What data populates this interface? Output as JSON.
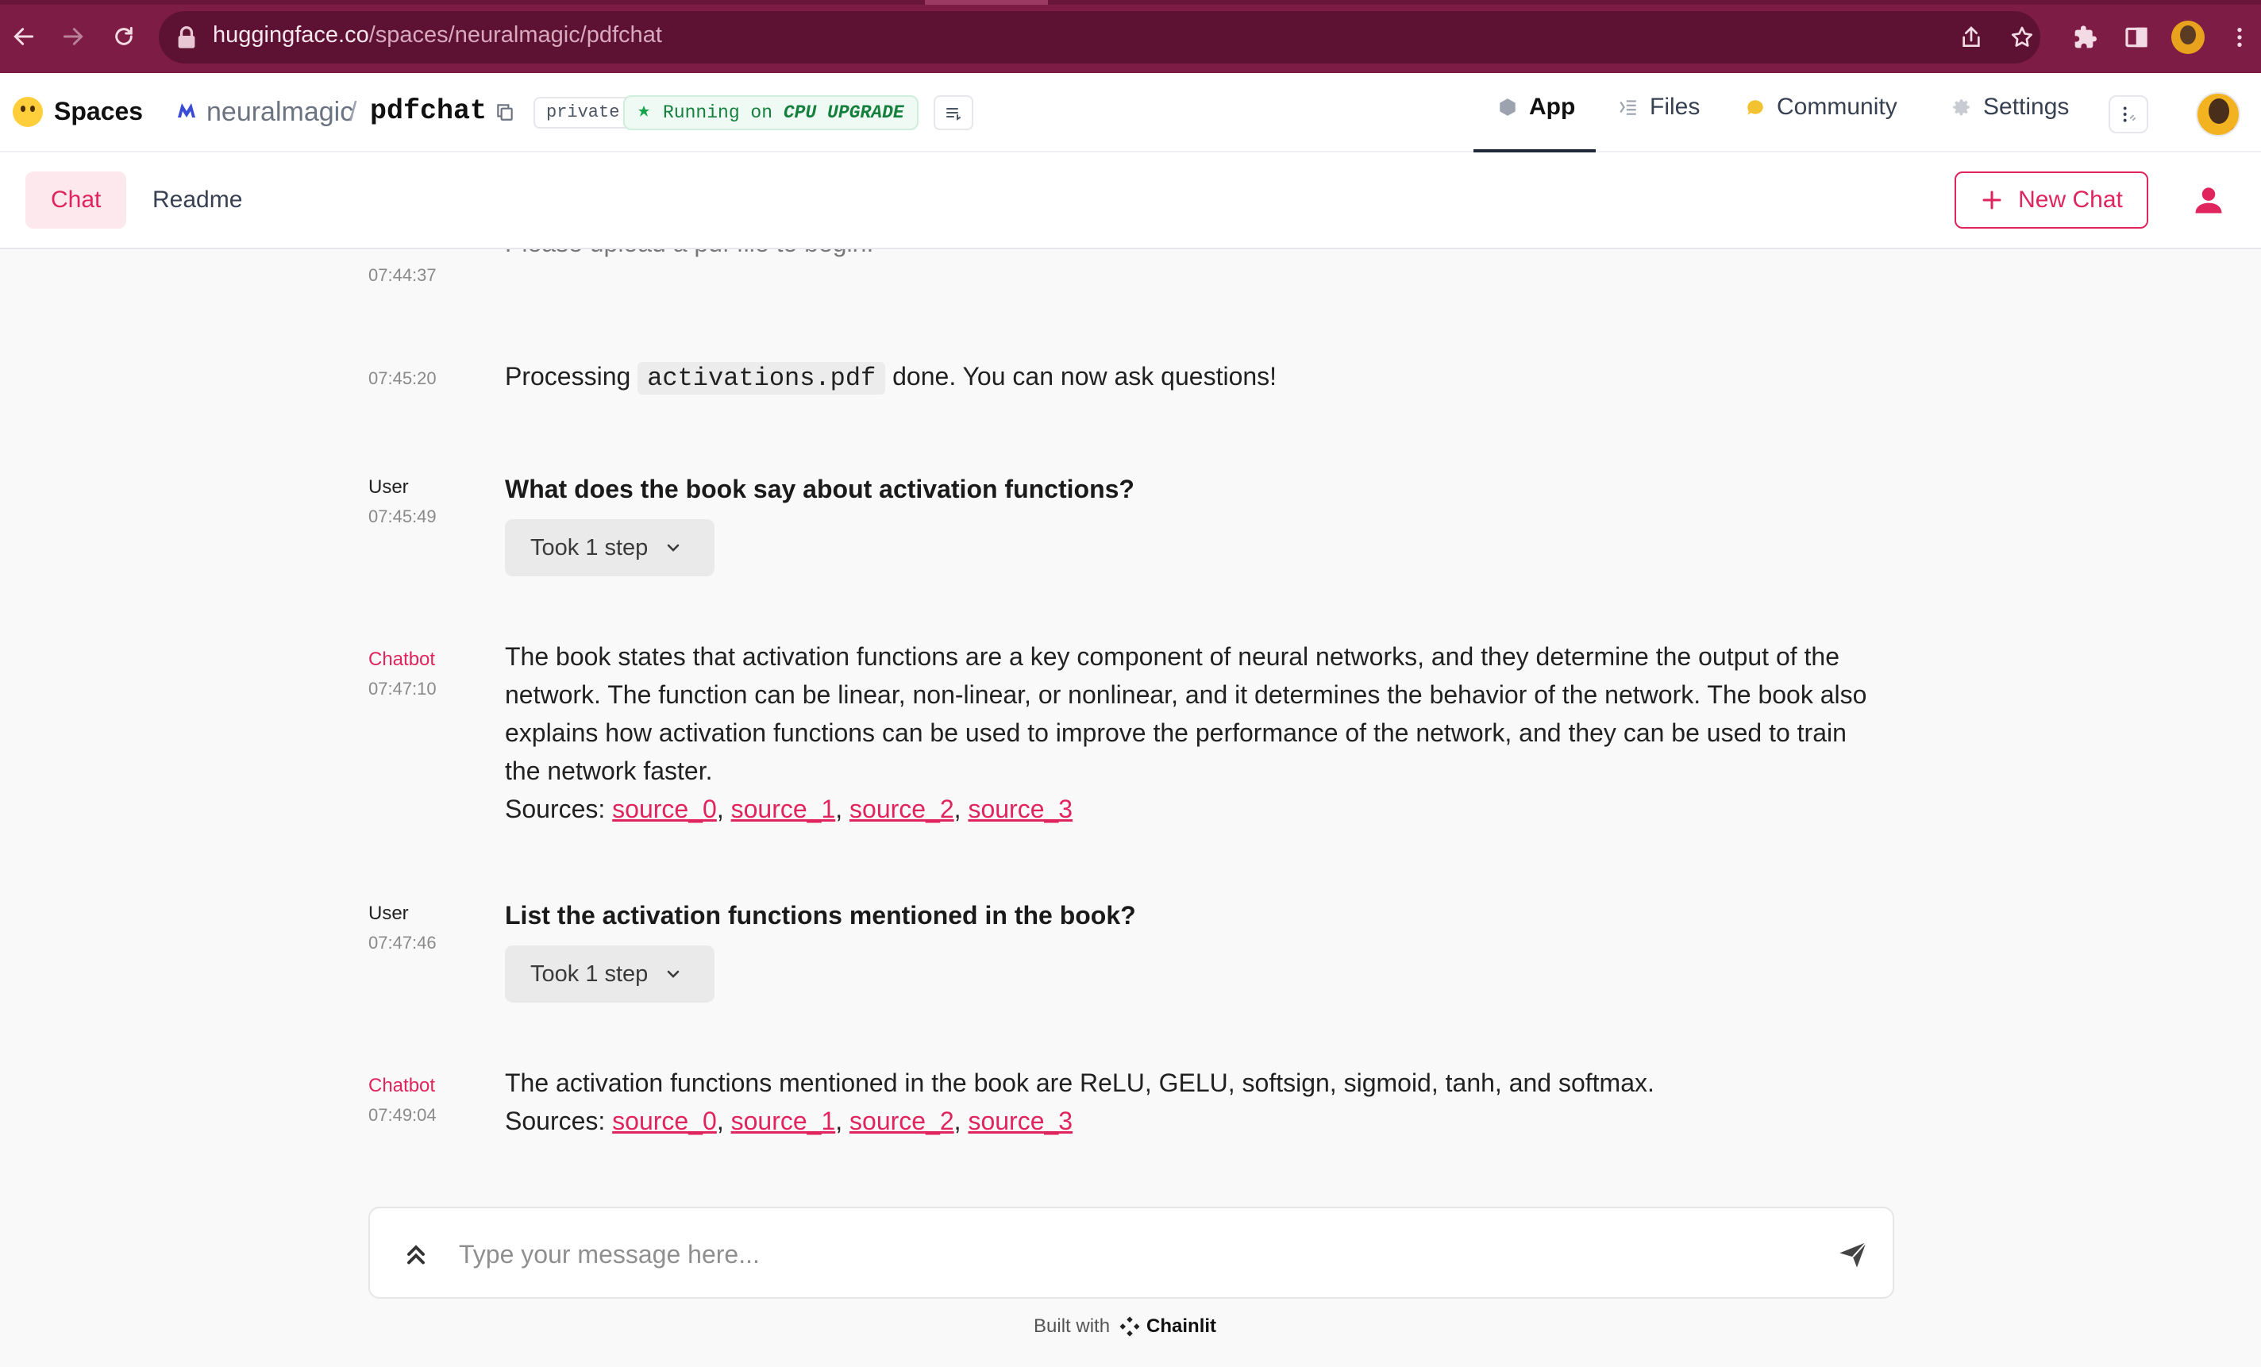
{
  "browser": {
    "url_host": "huggingface.co",
    "url_path": "/spaces/neuralmagic/pdfchat"
  },
  "hf_header": {
    "spaces_label": "Spaces",
    "org": "neuralmagic",
    "separator": "/",
    "repo": "pdfchat",
    "private_badge": "private",
    "status_prefix": "Running on",
    "status_hardware": "CPU UPGRADE",
    "tabs": [
      {
        "label": "App",
        "icon": "cube-icon",
        "active": true
      },
      {
        "label": "Files",
        "icon": "files-icon",
        "active": false
      },
      {
        "label": "Community",
        "icon": "community-icon",
        "active": false
      },
      {
        "label": "Settings",
        "icon": "gear-icon",
        "active": false
      }
    ]
  },
  "chainlit_header": {
    "tabs": [
      {
        "label": "Chat",
        "active": true
      },
      {
        "label": "Readme",
        "active": false
      }
    ],
    "new_chat_label": "New Chat"
  },
  "messages": [
    {
      "author": "",
      "time": "07:44:37",
      "text": "Please upload a pdf file to begin!"
    },
    {
      "author": "",
      "time": "07:45:20",
      "text_before": "Processing",
      "code": "activations.pdf",
      "text_after": "done. You can now ask questions!"
    },
    {
      "author": "User",
      "time": "07:45:49",
      "text": "What does the book say about activation functions?",
      "step_label": "Took 1 step"
    },
    {
      "author": "Chatbot",
      "time": "07:47:10",
      "text": "The book states that activation functions are a key component of neural networks, and they determine the output of the network. The function can be linear, non-linear, or nonlinear, and it determines the behavior of the network. The book also explains how activation functions can be used to improve the performance of the network, and they can be used to train the network faster.",
      "sources_label": "Sources:",
      "sources": [
        "source_0",
        "source_1",
        "source_2",
        "source_3"
      ]
    },
    {
      "author": "User",
      "time": "07:47:46",
      "text": "List the activation functions mentioned in the book?",
      "step_label": "Took 1 step"
    },
    {
      "author": "Chatbot",
      "time": "07:49:04",
      "text": "The activation functions mentioned in the book are ReLU, GELU, softsign, sigmoid, tanh, and softmax.",
      "sources_label": "Sources:",
      "sources": [
        "source_0",
        "source_1",
        "source_2",
        "source_3"
      ]
    }
  ],
  "composer": {
    "placeholder": "Type your message here..."
  },
  "footer": {
    "built_with": "Built with",
    "brand": "Chainlit"
  },
  "colors": {
    "browser_bar": "#7d1c44",
    "accent": "#e0245e",
    "running_green": "#15803d"
  }
}
